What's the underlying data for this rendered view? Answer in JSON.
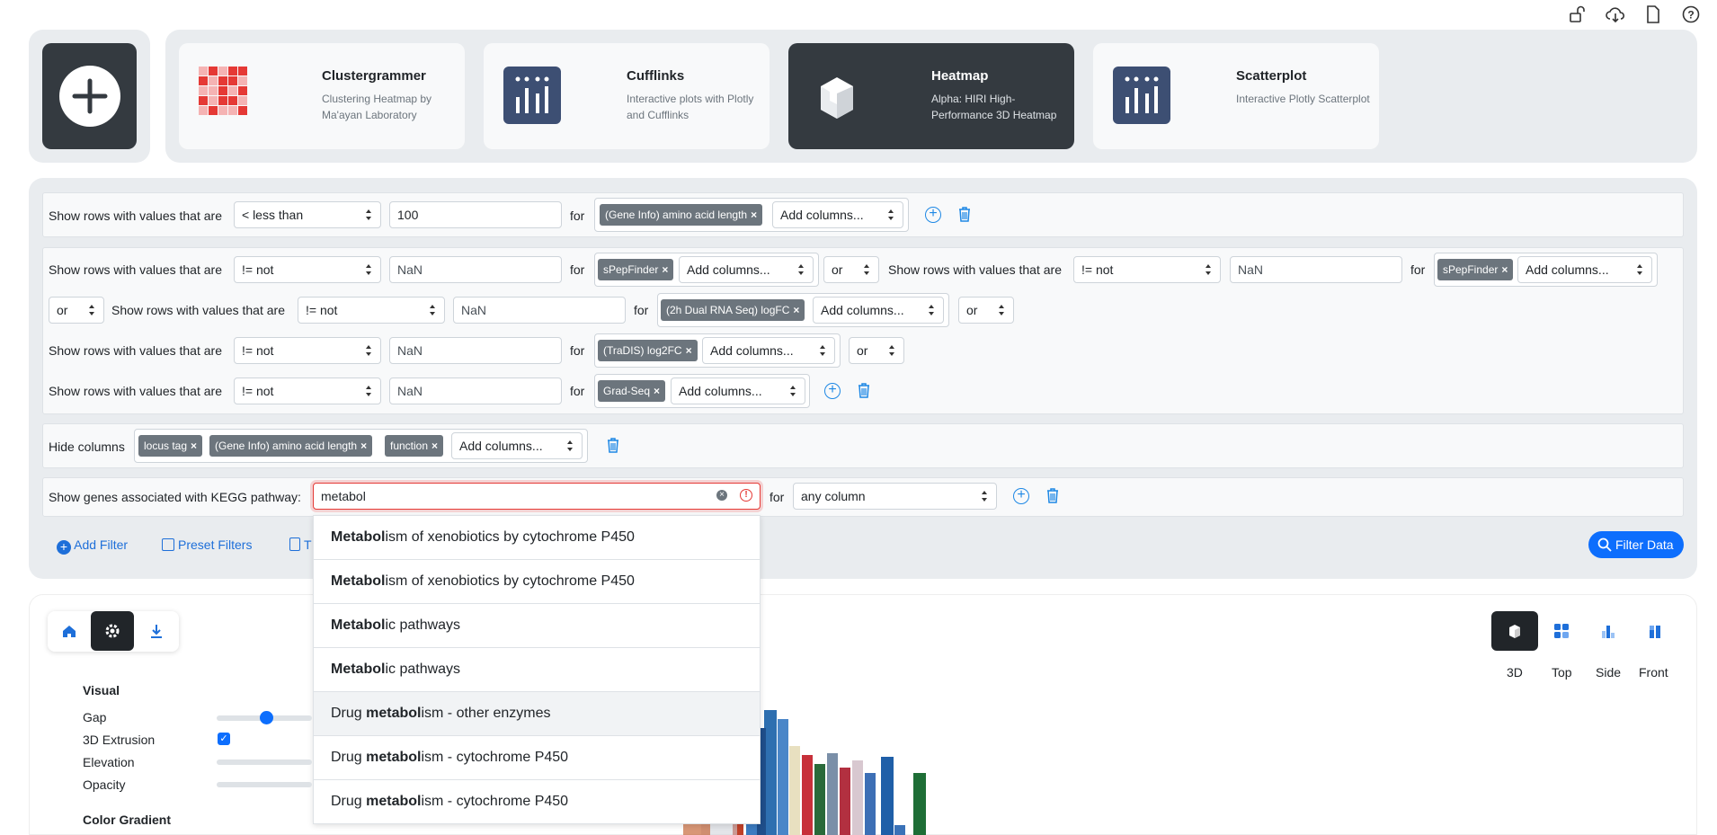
{
  "plugins": {
    "add_label": "",
    "cards": [
      {
        "title": "Clustergrammer",
        "desc": "Clustering Heatmap by Ma'ayan Laboratory"
      },
      {
        "title": "Cufflinks",
        "desc": "Interactive plots with Plotly and Cufflinks"
      },
      {
        "title": "Heatmap",
        "desc": "Alpha: HIRI High-Performance 3D Heatmap"
      },
      {
        "title": "Scatterplot",
        "desc": "Interactive Plotly Scatterplot"
      }
    ]
  },
  "filters": {
    "show_rows_label": "Show rows with values that are",
    "for_label": "for",
    "or_label": "or",
    "add_columns": "Add columns...",
    "row1": {
      "op": "< less than",
      "value": "100",
      "tag": "(Gene Info) amino acid length"
    },
    "row2a": {
      "op": "!= not",
      "value": "NaN",
      "tag": "sPepFinder"
    },
    "row2b": {
      "op": "!= not",
      "value": "NaN",
      "tag": "sPepFinder"
    },
    "row3": {
      "op": "!= not",
      "value": "NaN",
      "tag": "(2h Dual RNA Seq) logFC"
    },
    "row4": {
      "op": "!= not",
      "value": "NaN",
      "tag": "(TraDIS) log2FC"
    },
    "row5": {
      "op": "!= not",
      "value": "NaN",
      "tag": "Grad-Seq"
    },
    "hide": {
      "label": "Hide columns",
      "tags": [
        "locus tag",
        "(Gene Info) amino acid length",
        "function"
      ]
    },
    "kegg": {
      "label": "Show genes associated with KEGG pathway:",
      "value": "metabol",
      "column": "any column"
    }
  },
  "actions": {
    "add_filter": "Add Filter",
    "preset_filters": "Preset Filters",
    "third_partial": "T",
    "filter_data": "Filter Data"
  },
  "dropdown": [
    {
      "bold": "Metabol",
      "rest": "ism of xenobiotics by cytochrome P450",
      "pre": ""
    },
    {
      "bold": "Metabol",
      "rest": "ism of xenobiotics by cytochrome P450",
      "pre": ""
    },
    {
      "bold": "Metabol",
      "rest": "ic pathways",
      "pre": ""
    },
    {
      "bold": "Metabol",
      "rest": "ic pathways",
      "pre": ""
    },
    {
      "pre": "Drug ",
      "bold": "metabol",
      "rest": "ism - other enzymes"
    },
    {
      "pre": "Drug ",
      "bold": "metabol",
      "rest": "ism - cytochrome P450"
    },
    {
      "pre": "Drug ",
      "bold": "metabol",
      "rest": "ism - cytochrome P450"
    }
  ],
  "viz": {
    "settings": {
      "visual": "Visual",
      "gap": "Gap",
      "extrusion": "3D Extrusion",
      "elevation": "Elevation",
      "opacity": "Opacity",
      "color_gradient": "Color Gradient"
    },
    "views": [
      "3D",
      "Top",
      "Side",
      "Front"
    ]
  },
  "colors": {
    "accent": "#0d6efd",
    "dark": "#343a40"
  }
}
